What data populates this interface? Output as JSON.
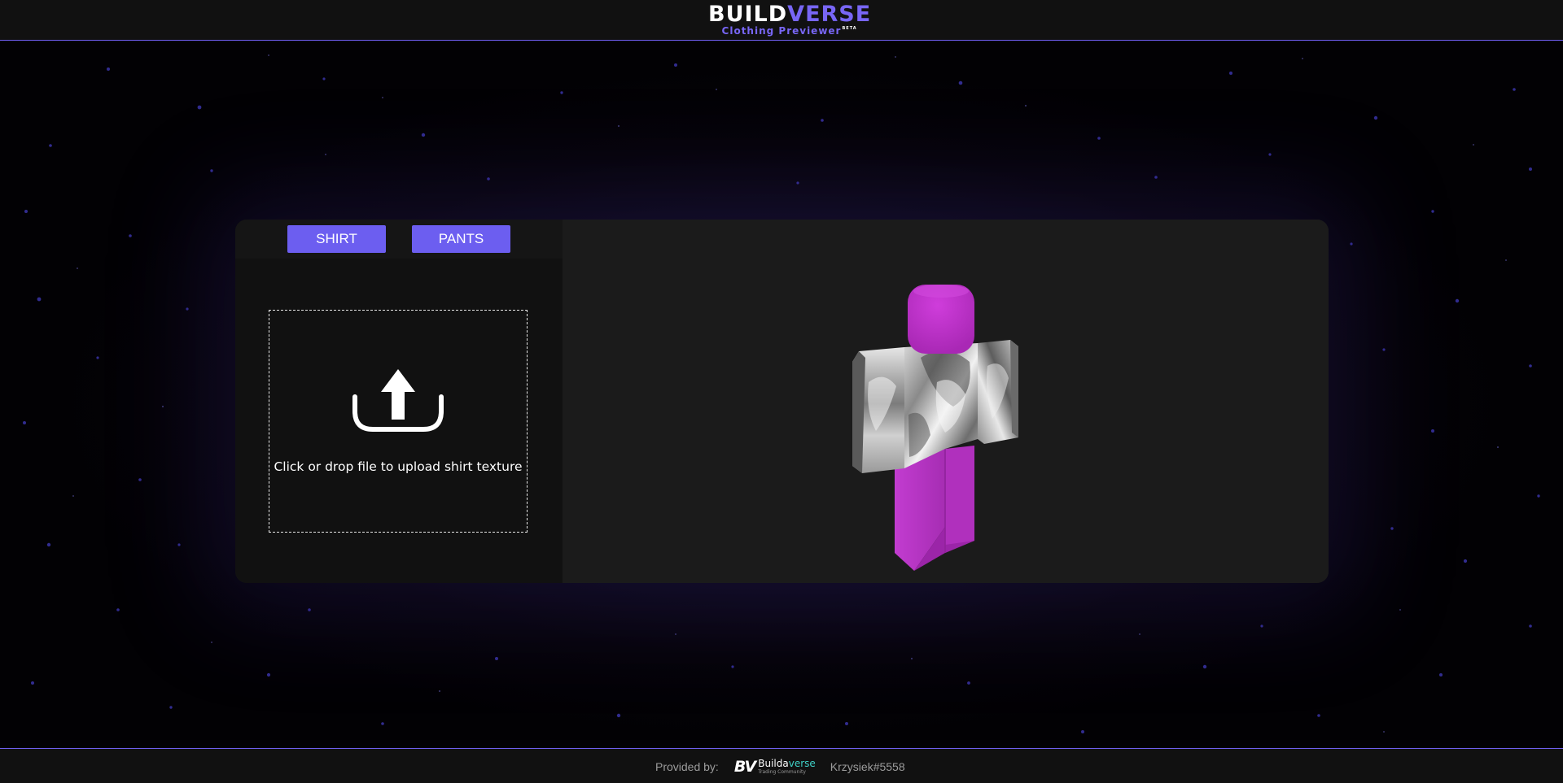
{
  "header": {
    "logo_part1": "BUILD",
    "logo_part2": "VERSE",
    "logo_sub": "Clothing Previewer",
    "logo_badge": "BETA"
  },
  "tabs": [
    {
      "label": "SHIRT"
    },
    {
      "label": "PANTS"
    }
  ],
  "upload": {
    "text": "Click or drop file to upload shirt texture",
    "icon": "upload-icon"
  },
  "footer": {
    "provided_label": "Provided by:",
    "provider_mark": "BV",
    "provider_name_part1": "Builda",
    "provider_name_part2": "verse",
    "provider_tagline": "Trading Community",
    "author_handle": "Krzysiek#5558"
  },
  "colors": {
    "accent": "#6c5ef0",
    "header_bg": "#111111",
    "panel_bg": "#1b1b1b",
    "avatar_magenta": "#b62fc0",
    "teal": "#3fd0c6"
  }
}
